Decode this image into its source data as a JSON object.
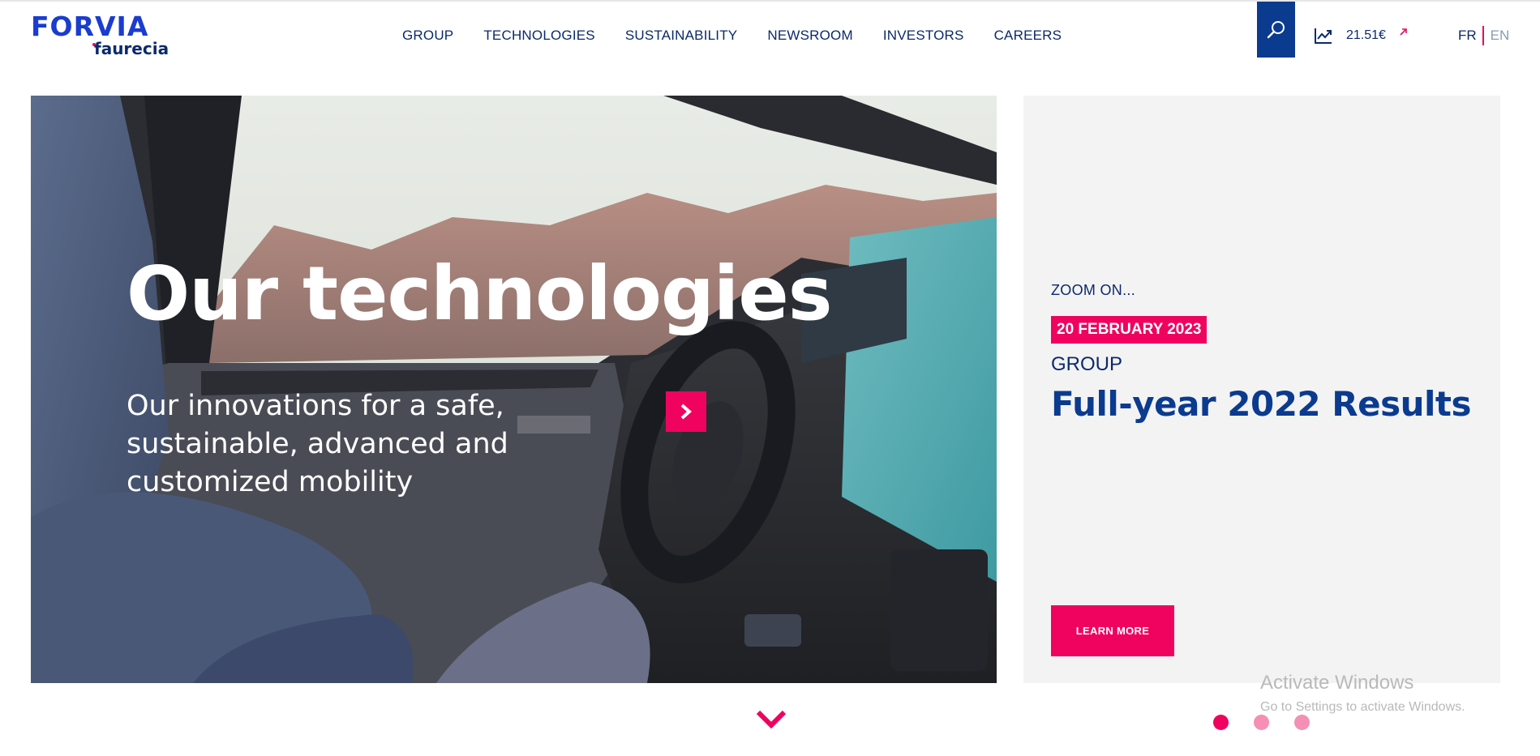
{
  "brand": {
    "name": "FORVIA",
    "sub": "faurecia"
  },
  "nav": {
    "items": [
      {
        "label": "GROUP"
      },
      {
        "label": "TECHNOLOGIES"
      },
      {
        "label": "SUSTAINABILITY"
      },
      {
        "label": "NEWSROOM"
      },
      {
        "label": "INVESTORS"
      },
      {
        "label": "CAREERS"
      }
    ]
  },
  "header": {
    "search_icon": "search-icon",
    "stock_icon": "trend-chart-icon",
    "stock_value": "21.51€",
    "stock_trend_icon": "arrow-up-right-icon",
    "lang_fr": "FR",
    "lang_en": "EN"
  },
  "hero": {
    "title": "Our technologies",
    "subtitle": "Our innovations for a safe, sustainable, advanced and customized mobility",
    "next_icon": "chevron-right-icon"
  },
  "panel": {
    "zoom_label": "ZOOM ON...",
    "date": "20 FEBRUARY 2023",
    "category": "GROUP",
    "headline": "Full-year 2022 Results",
    "cta": "LEARN MORE"
  },
  "carousel": {
    "count": 3,
    "active_index": 0
  },
  "watermark": {
    "title": "Activate Windows",
    "subtitle": "Go to Settings to activate Windows."
  },
  "colors": {
    "brand_blue": "#0b3b8f",
    "navy": "#0b2a6b",
    "accent_pink": "#f0025f",
    "panel_bg": "#f3f3f3"
  }
}
